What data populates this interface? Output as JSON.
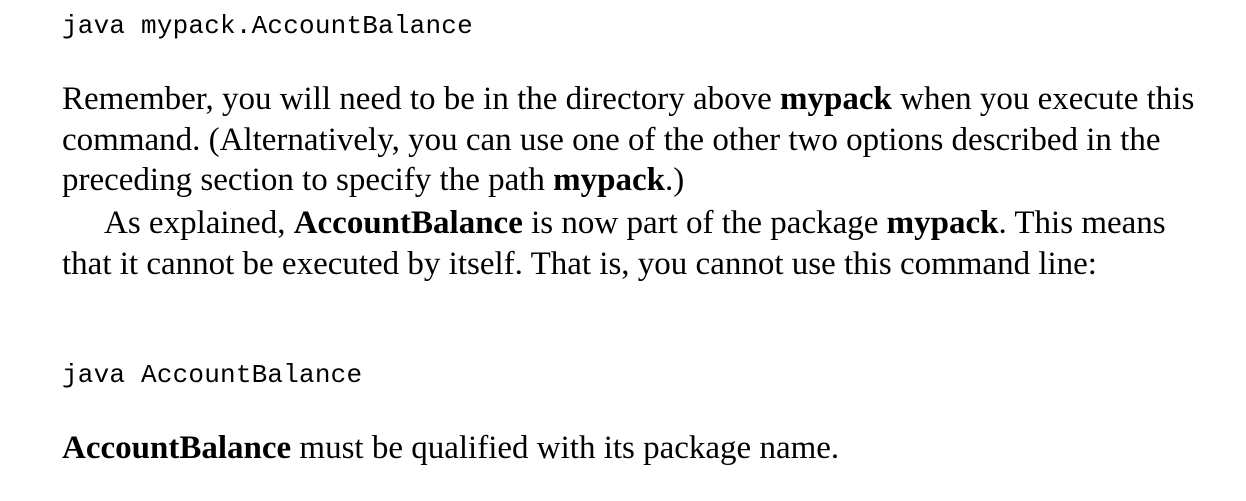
{
  "code_block_1": "java mypack.AccountBalance",
  "paragraph_1": {
    "t1": "Remember, you will need to be in the directory above ",
    "b1": "mypack",
    "t2": " when you execute this command. (Alternatively, you can use one of the other two options described in the preceding section to specify the path ",
    "b2": "mypack",
    "t3": ".)"
  },
  "paragraph_2": {
    "t1": "As explained, ",
    "b1": "AccountBalance",
    "t2": " is now part of the package ",
    "b2": "mypack",
    "t3": ". This means that it cannot be executed by itself. That is, you cannot use this command line:"
  },
  "code_block_2": "java AccountBalance",
  "paragraph_3": {
    "b1": "AccountBalance",
    "t1": " must be qualified with its package name."
  }
}
